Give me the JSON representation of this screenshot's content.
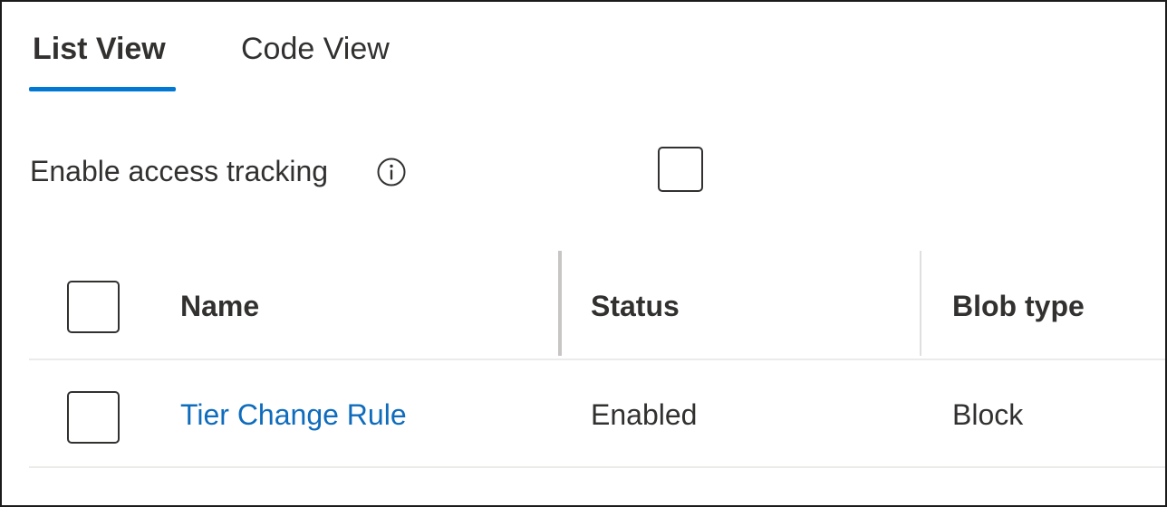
{
  "tabs": [
    {
      "label": "List View",
      "selected": true
    },
    {
      "label": "Code View",
      "selected": false
    }
  ],
  "access_tracking": {
    "label": "Enable access tracking",
    "info_icon": "info-circle-icon",
    "checked": false
  },
  "grid": {
    "select_all_checked": false,
    "columns": [
      "Name",
      "Status",
      "Blob type"
    ],
    "rows": [
      {
        "name": "Tier Change Rule",
        "status": "Enabled",
        "blob_type": "Block",
        "checked": false
      }
    ]
  },
  "colors": {
    "accent": "#0078d4",
    "link": "#0f6cbd",
    "text": "#323130",
    "divider": "#edebe9"
  }
}
